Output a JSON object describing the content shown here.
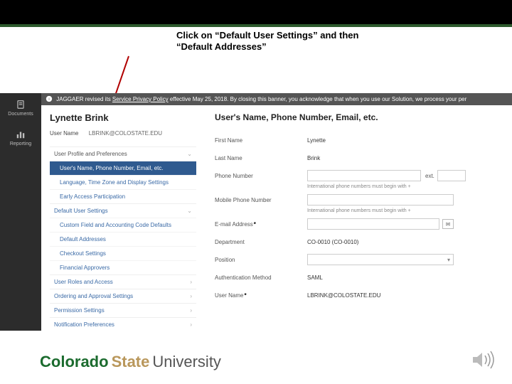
{
  "instruction": "Click on “Default User Settings” and then “Default Addresses”",
  "banner": {
    "prefix": "JAGGAER revised its ",
    "link": "Service Privacy Policy",
    "suffix": " effective May 25, 2018. By closing this banner, you acknowledge that when you use our Solution, we process your per"
  },
  "sidenav": {
    "documents": "Documents",
    "reporting": "Reporting"
  },
  "profile": {
    "name": "Lynette Brink",
    "username_label": "User Name",
    "username_value": "LBRINK@COLOSTATE.EDU"
  },
  "menu": {
    "section1": "User Profile and Preferences",
    "item1": "User's Name, Phone Number, Email, etc.",
    "item2": "Language, Time Zone and Display Settings",
    "item3": "Early Access Participation",
    "section2": "Default User Settings",
    "item4": "Custom Field and Accounting Code Defaults",
    "item5": "Default Addresses",
    "item6": "Checkout Settings",
    "item7": "Financial Approvers",
    "section3": "User Roles and Access",
    "section4": "Ordering and Approval Settings",
    "section5": "Permission Settings",
    "section6": "Notification Preferences"
  },
  "form": {
    "title": "User's Name, Phone Number, Email, etc.",
    "first_name_label": "First Name",
    "first_name_value": "Lynette",
    "last_name_label": "Last Name",
    "last_name_value": "Brink",
    "phone_label": "Phone Number",
    "ext_label": "ext.",
    "phone_hint": "International phone numbers must begin with +",
    "mobile_label": "Mobile Phone Number",
    "mobile_hint": "International phone numbers must begin with +",
    "email_label": "E-mail Address",
    "dept_label": "Department",
    "dept_value": "CO-0010 (CO-0010)",
    "position_label": "Position",
    "auth_label": "Authentication Method",
    "auth_value": "SAML",
    "user_label": "User Name",
    "user_value": "LBRINK@COLOSTATE.EDU"
  },
  "logo": {
    "c": "Colorado",
    "s": "State",
    "u": "University"
  }
}
